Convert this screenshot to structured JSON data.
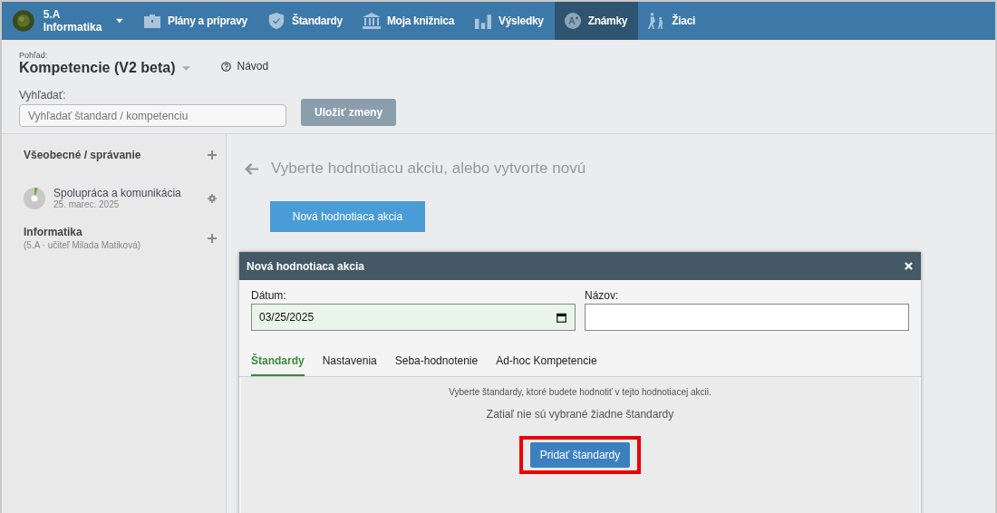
{
  "class_switcher": {
    "class": "5.A",
    "subject": "Informatika"
  },
  "nav": [
    {
      "label": "Plány a prípravy",
      "selected": false
    },
    {
      "label": "Štandardy",
      "selected": false
    },
    {
      "label": "Moja knižnica",
      "selected": false
    },
    {
      "label": "Výsledky",
      "selected": false
    },
    {
      "label": "Známky",
      "selected": true
    },
    {
      "label": "Žiaci",
      "selected": false
    }
  ],
  "view": {
    "caption": "Pohľad:",
    "title": "Kompetencie (V2 beta)",
    "help": "Návod"
  },
  "search": {
    "label": "Vyhľadať:",
    "placeholder": "Vyhľadať štandard / kompetenciu"
  },
  "save_button": {
    "label": "Uložiť zmeny",
    "disabled": true
  },
  "sidebar": [
    {
      "kind": "group",
      "title": "Všeobecné / správanie"
    },
    {
      "kind": "action",
      "title": "Spolupráca a komunikácia",
      "subtitle": "25. marec. 2025"
    },
    {
      "kind": "group",
      "title": "Informatika",
      "subtitle": "(5.A · učiteľ Milada Matiková)"
    }
  ],
  "main": {
    "prompt": "Vyberte hodnotiacu akciu, alebo vytvorte novú",
    "new_button": "Nová hodnotiaca akcia"
  },
  "dialog": {
    "title": "Nová hodnotiaca akcia",
    "date_label": "Dátum:",
    "date_value": "03/25/2025",
    "name_label": "Názov:",
    "tabs": [
      {
        "label": "Štandardy",
        "selected": true
      },
      {
        "label": "Nastavenia",
        "selected": false
      },
      {
        "label": "Seba-hodnotenie",
        "selected": false
      },
      {
        "label": "Ad-hoc Kompetencie",
        "selected": false
      }
    ],
    "hint": "Vyberte štandardy, ktoré budete hodnotiť v tejto hodnotiacej akcii.",
    "empty": "Zatiaľ nie sú vybrané žiadne štandardy",
    "add_button": "Pridať štandardy",
    "add_highlighted": true
  }
}
